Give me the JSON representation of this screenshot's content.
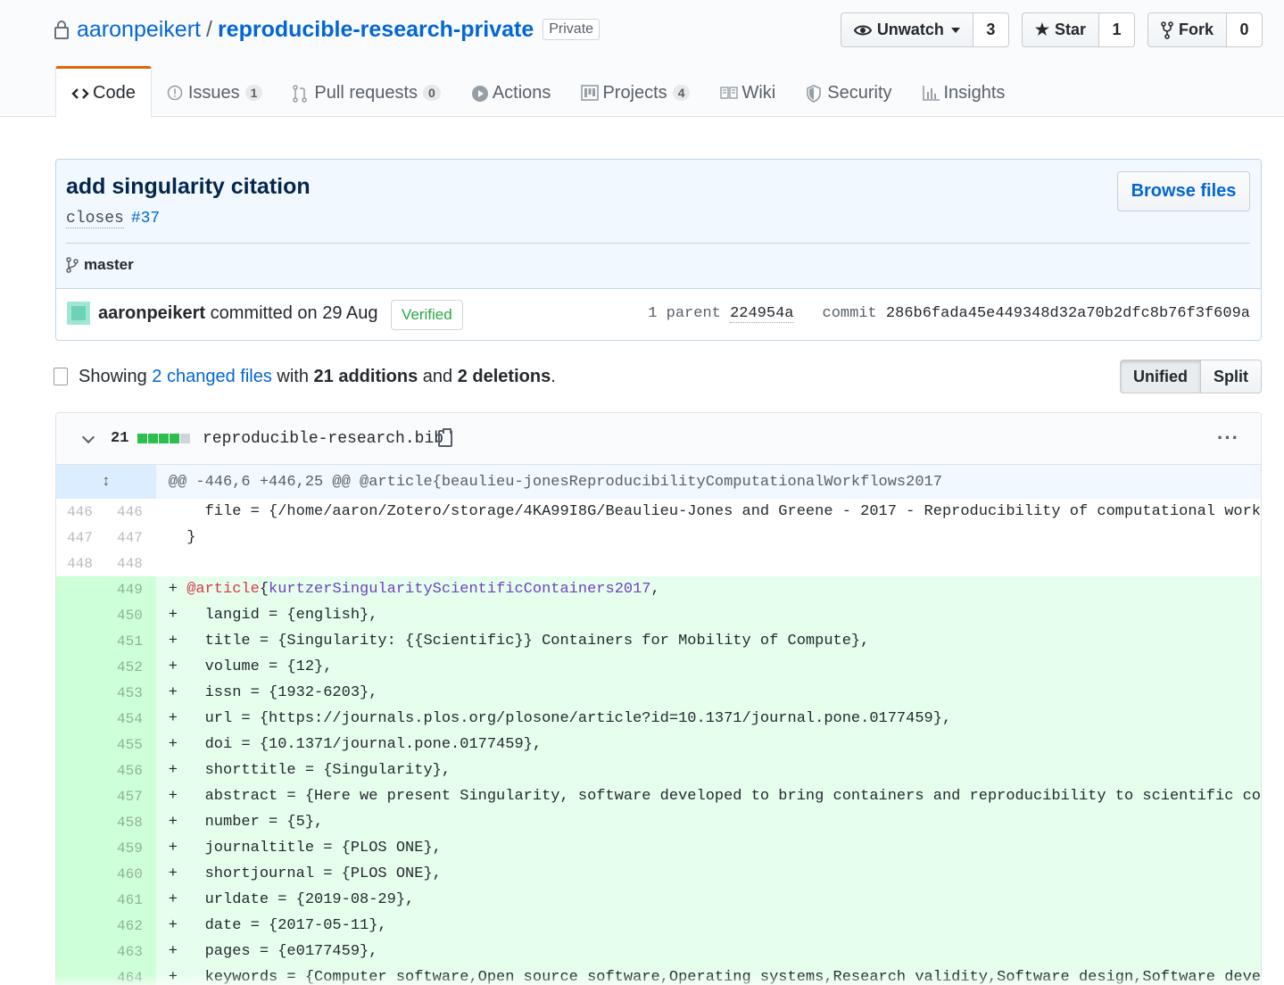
{
  "repo": {
    "owner": "aaronpeikert",
    "separator": "/",
    "name": "reproducible-research-private",
    "visibility": "Private"
  },
  "actions": {
    "watch_label": "Unwatch",
    "watch_count": "3",
    "star_label": "Star",
    "star_count": "1",
    "fork_label": "Fork",
    "fork_count": "0"
  },
  "nav": [
    {
      "label": "Code",
      "icon": "code-icon",
      "counter": ""
    },
    {
      "label": "Issues",
      "icon": "issue-opened-icon",
      "counter": "1"
    },
    {
      "label": "Pull requests",
      "icon": "git-pull-request-icon",
      "counter": "0"
    },
    {
      "label": "Actions",
      "icon": "play-icon",
      "counter": ""
    },
    {
      "label": "Projects",
      "icon": "project-icon",
      "counter": "4"
    },
    {
      "label": "Wiki",
      "icon": "book-icon",
      "counter": ""
    },
    {
      "label": "Security",
      "icon": "shield-icon",
      "counter": ""
    },
    {
      "label": "Insights",
      "icon": "graph-icon",
      "counter": ""
    }
  ],
  "commit": {
    "title": "add singularity citation",
    "desc_prefix": "closes",
    "desc_issue": "#37",
    "browse_label": "Browse files",
    "branch": "master",
    "author": "aaronpeikert",
    "committed_text": "committed on 29 Aug",
    "verified_label": "Verified",
    "parent_label": "1 parent",
    "parent_sha": "224954a",
    "commit_label": "commit",
    "sha": "286b6fada45e449348d32a70b2dfc8b76f3f609a"
  },
  "toc": {
    "showing": "Showing",
    "changed_files": "2 changed files",
    "with": "with",
    "additions": "21 additions",
    "and": "and",
    "deletions": "2 deletions",
    "period": "."
  },
  "view_toggle": {
    "unified": "Unified",
    "split": "Split"
  },
  "file": {
    "stat_count": "21",
    "stat_blocks": [
      "add",
      "add",
      "add",
      "add",
      "neutral"
    ],
    "path": "reproducible-research.bib",
    "more": "···",
    "hunk_header": "@@ -446,6 +446,25 @@ @article{beaulieu-jonesReproducibilityComputationalWorkflows2017",
    "expander": "↕"
  },
  "lines": [
    {
      "type": "ctx",
      "old": "446",
      "new": "446",
      "text": "    file = {/home/aaron/Zotero/storage/4KA99I8G/Beaulieu-Jones and Greene - 2017 - Reproducibility of computational work"
    },
    {
      "type": "ctx",
      "old": "447",
      "new": "447",
      "text": "  }"
    },
    {
      "type": "ctx",
      "old": "448",
      "new": "448",
      "text": ""
    },
    {
      "type": "add",
      "old": "",
      "new": "449",
      "text": "+ ",
      "kw": "@article",
      "brace": "{",
      "fn": "kurtzerSingularityScientificContainers2017",
      "rest": ","
    },
    {
      "type": "add",
      "old": "",
      "new": "450",
      "text": "+   langid = {english},"
    },
    {
      "type": "add",
      "old": "",
      "new": "451",
      "text": "+   title = {Singularity: {{Scientific}} Containers for Mobility of Compute},"
    },
    {
      "type": "add",
      "old": "",
      "new": "452",
      "text": "+   volume = {12},"
    },
    {
      "type": "add",
      "old": "",
      "new": "453",
      "text": "+   issn = {1932-6203},"
    },
    {
      "type": "add",
      "old": "",
      "new": "454",
      "text": "+   url = {https://journals.plos.org/plosone/article?id=10.1371/journal.pone.0177459},"
    },
    {
      "type": "add",
      "old": "",
      "new": "455",
      "text": "+   doi = {10.1371/journal.pone.0177459},"
    },
    {
      "type": "add",
      "old": "",
      "new": "456",
      "text": "+   shorttitle = {Singularity},"
    },
    {
      "type": "add",
      "old": "",
      "new": "457",
      "text": "+   abstract = {Here we present Singularity, software developed to bring containers and reproducibility to scientific co"
    },
    {
      "type": "add",
      "old": "",
      "new": "458",
      "text": "+   number = {5},"
    },
    {
      "type": "add",
      "old": "",
      "new": "459",
      "text": "+   journaltitle = {PLOS ONE},"
    },
    {
      "type": "add",
      "old": "",
      "new": "460",
      "text": "+   shortjournal = {PLOS ONE},"
    },
    {
      "type": "add",
      "old": "",
      "new": "461",
      "text": "+   urldate = {2019-08-29},"
    },
    {
      "type": "add",
      "old": "",
      "new": "462",
      "text": "+   date = {2017-05-11},"
    },
    {
      "type": "add",
      "old": "",
      "new": "463",
      "text": "+   pages = {e0177459},"
    },
    {
      "type": "add",
      "old": "",
      "new": "464",
      "text": "+   keywords = {Computer software,Open source software,Operating systems,Research validity,Software design,Software deve"
    }
  ],
  "colors": {
    "link": "#0366d6",
    "nav_selected_border": "#e36209",
    "add_bg": "#e6ffed",
    "add_num_bg": "#cdffd8",
    "hunk_bg": "#f1f8ff",
    "verified": "#28a745"
  }
}
